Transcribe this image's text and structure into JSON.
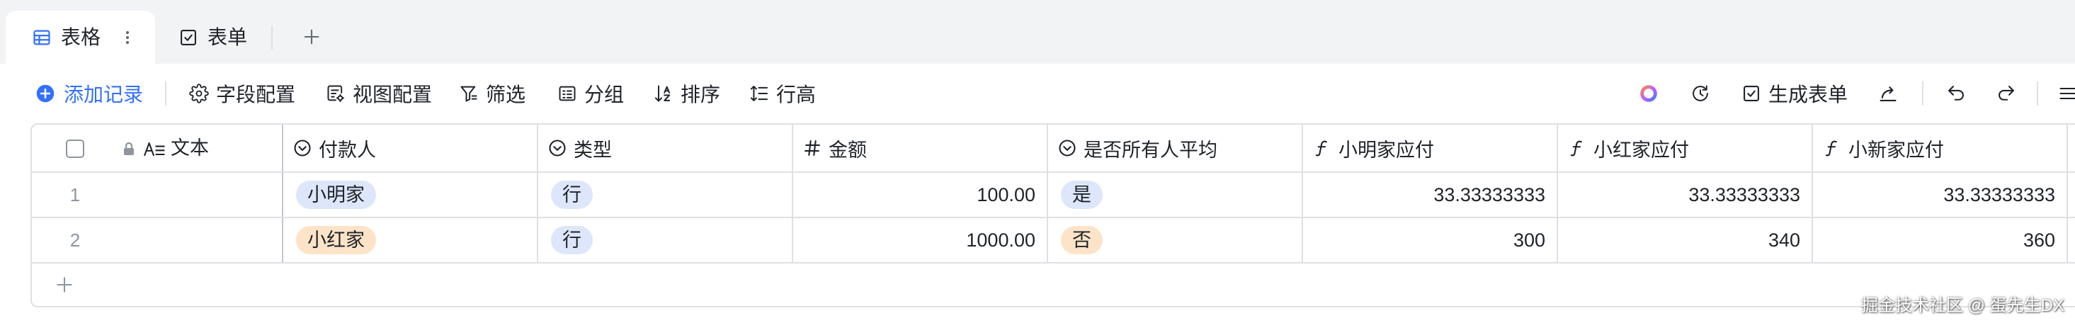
{
  "tabs": [
    {
      "label": "表格",
      "icon": "grid-icon",
      "active": true
    },
    {
      "label": "表单",
      "icon": "form-icon",
      "active": false
    }
  ],
  "tab_bar": {
    "more_icon": "more-vertical-icon",
    "add_tab_icon": "plus-icon"
  },
  "toolbar": {
    "add_record": {
      "label": "添加记录",
      "icon": "add-circle-icon"
    },
    "field_config": {
      "label": "字段配置",
      "icon": "gear-icon"
    },
    "view_config": {
      "label": "视图配置",
      "icon": "view-config-icon"
    },
    "filter": {
      "label": "筛选",
      "icon": "filter-icon"
    },
    "group": {
      "label": "分组",
      "icon": "group-icon"
    },
    "sort": {
      "label": "排序",
      "icon": "sort-icon"
    },
    "row_height": {
      "label": "行高",
      "icon": "row-height-icon"
    },
    "right": {
      "ai_icon": "ai-ring-icon",
      "history_icon": "history-icon",
      "generate_form": {
        "label": "生成表单",
        "icon": "form-check-icon"
      },
      "share_icon": "share-icon",
      "undo_icon": "undo-icon",
      "redo_icon": "redo-icon"
    }
  },
  "table": {
    "columns": [
      {
        "label": "文本",
        "type": "text",
        "icon": "text-type-icon",
        "locked": true
      },
      {
        "label": "付款人",
        "type": "single-select",
        "icon": "select-icon"
      },
      {
        "label": "类型",
        "type": "single-select",
        "icon": "select-icon"
      },
      {
        "label": "金额",
        "type": "number",
        "icon": "number-icon"
      },
      {
        "label": "是否所有人平均",
        "type": "single-select",
        "icon": "select-icon"
      },
      {
        "label": "小明家应付",
        "type": "formula",
        "icon": "formula-icon"
      },
      {
        "label": "小红家应付",
        "type": "formula",
        "icon": "formula-icon"
      },
      {
        "label": "小新家应付",
        "type": "formula",
        "icon": "formula-icon"
      }
    ],
    "rows": [
      {
        "index": "1",
        "payer": {
          "value": "小明家",
          "color": "#dde6fa"
        },
        "type": {
          "value": "行",
          "color": "#dde6fa"
        },
        "amount": "100.00",
        "split_evenly": {
          "value": "是",
          "color": "#dde6fa"
        },
        "xiaoming_due": "33.33333333",
        "xiaohong_due": "33.33333333",
        "xiaoxin_due": "33.33333333"
      },
      {
        "index": "2",
        "payer": {
          "value": "小红家",
          "color": "#fde4c8"
        },
        "type": {
          "value": "行",
          "color": "#dde6fa"
        },
        "amount": "1000.00",
        "split_evenly": {
          "value": "否",
          "color": "#fde4c8"
        },
        "xiaoming_due": "300",
        "xiaohong_due": "340",
        "xiaoxin_due": "360"
      }
    ],
    "add_row_icon": "plus-icon"
  },
  "colors": {
    "accent": "#3370ff",
    "text": "#1f2329",
    "muted": "#8f959e",
    "border": "#dee0e3",
    "tab_bar_bg": "#f2f3f5"
  },
  "watermark": "掘金技术社区 @ 蛋先生DX"
}
